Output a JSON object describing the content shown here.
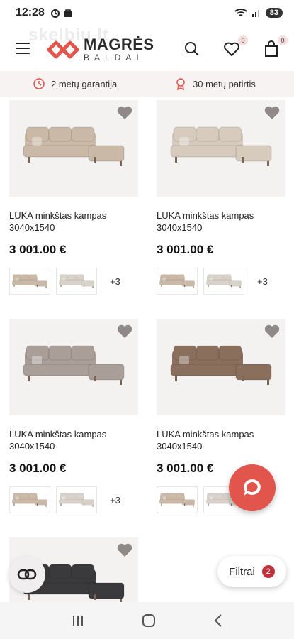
{
  "status_bar": {
    "time": "12:28",
    "battery": "83"
  },
  "header": {
    "watermark": "skelbiu.lt",
    "logo_main": "MAGRĖS",
    "logo_sub": "BALDAI",
    "favorites_count": "0",
    "cart_count": "0"
  },
  "perks": {
    "warranty": "2 metų garantija",
    "experience": "30 metų patirtis"
  },
  "products": [
    {
      "title": "LUKA minkštas kampas 3040x1540",
      "price": "3 001.00 €",
      "more": "+3",
      "color": "#c9b9a6"
    },
    {
      "title": "LUKA minkštas kampas 3040x1540",
      "price": "3 001.00 €",
      "more": "+3",
      "color": "#d6cbbd"
    },
    {
      "title": "LUKA minkštas kampas 3040x1540",
      "price": "3 001.00 €",
      "more": "+3",
      "color": "#a99e98"
    },
    {
      "title": "LUKA minkštas kampas 3040x1540",
      "price": "3 001.00 €",
      "more": "",
      "color": "#8a6f5d"
    },
    {
      "title": "",
      "price": "",
      "more": "",
      "color": "#3a3a3c"
    }
  ],
  "filter": {
    "label": "Filtrai",
    "count": "2"
  },
  "colors": {
    "accent": "#e1554c",
    "badge": "#c0303a",
    "perks_bg": "#f6f3f2"
  }
}
